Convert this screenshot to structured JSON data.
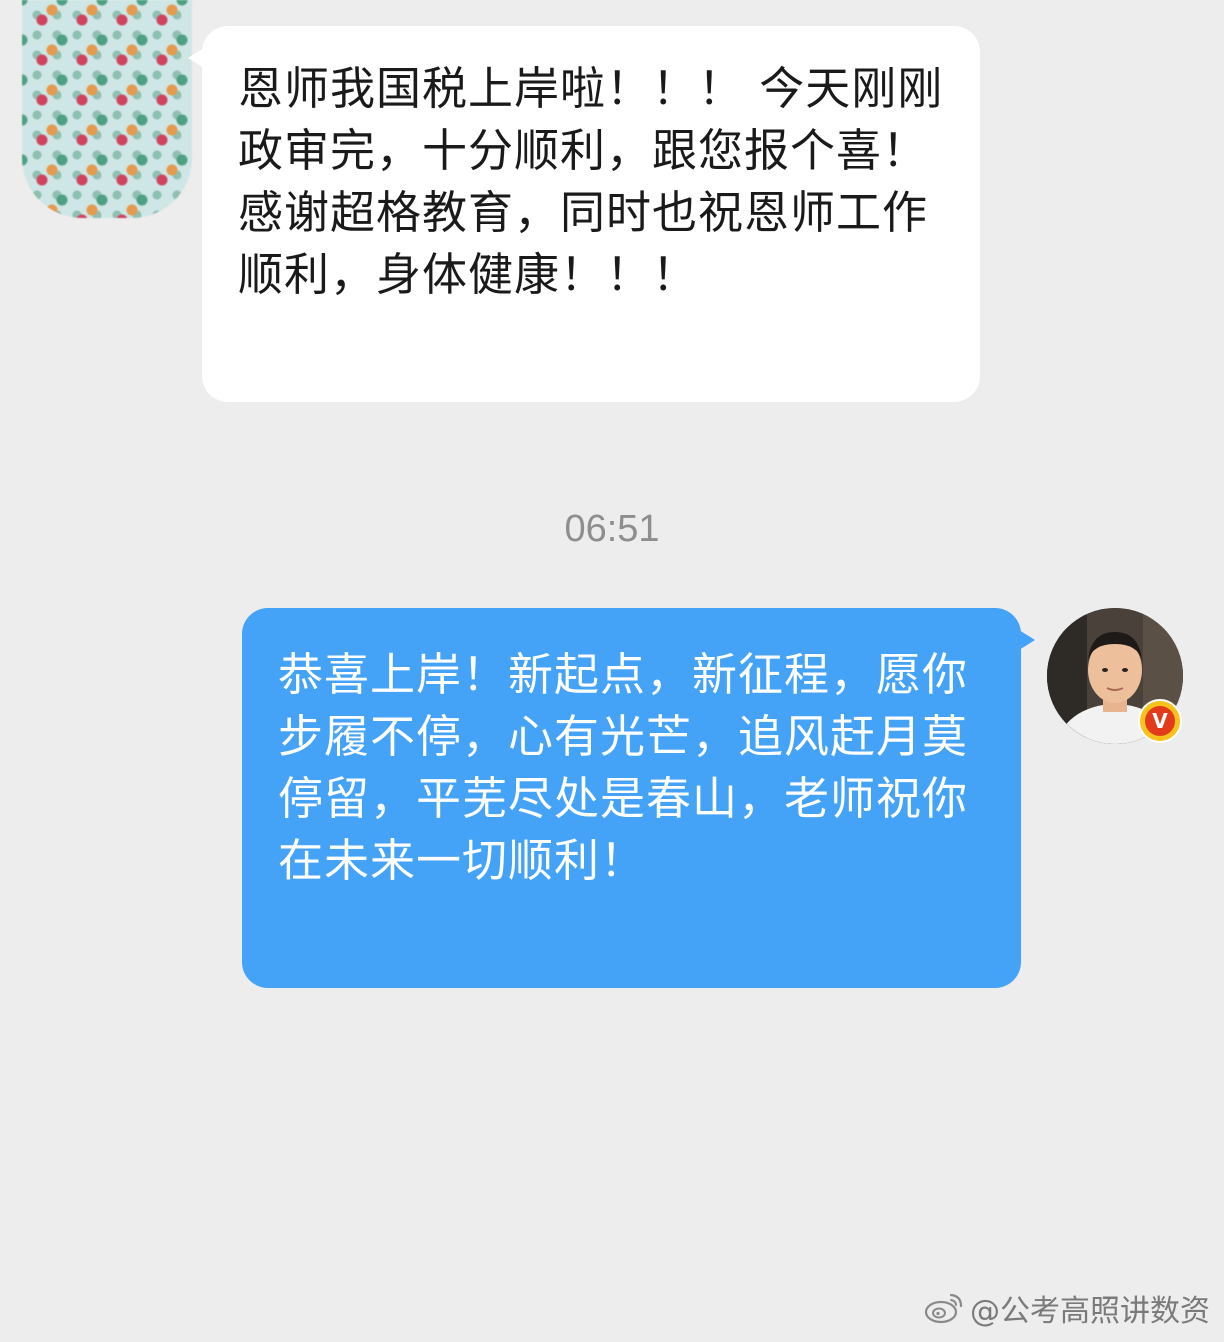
{
  "incoming_message": {
    "text": "恩师我国税上岸啦！！！ 今天刚刚政审完，十分顺利，跟您报个喜！感谢超格教育，同时也祝恩师工作顺利，身体健康！！！"
  },
  "timestamp": "06:51",
  "outgoing_message": {
    "text": "恭喜上岸！新起点，新征程，愿你步履不停，心有光芒，追风赶月莫停留，平芜尽处是春山，老师祝你在未来一切顺利！"
  },
  "verified_badge": {
    "label": "V",
    "color": "#f7c21c"
  },
  "watermark": {
    "text": "@公考高照讲数资",
    "icon": "weibo-icon"
  },
  "colors": {
    "background": "#ededed",
    "incoming_bubble": "#ffffff",
    "outgoing_bubble": "#44a2f7"
  }
}
